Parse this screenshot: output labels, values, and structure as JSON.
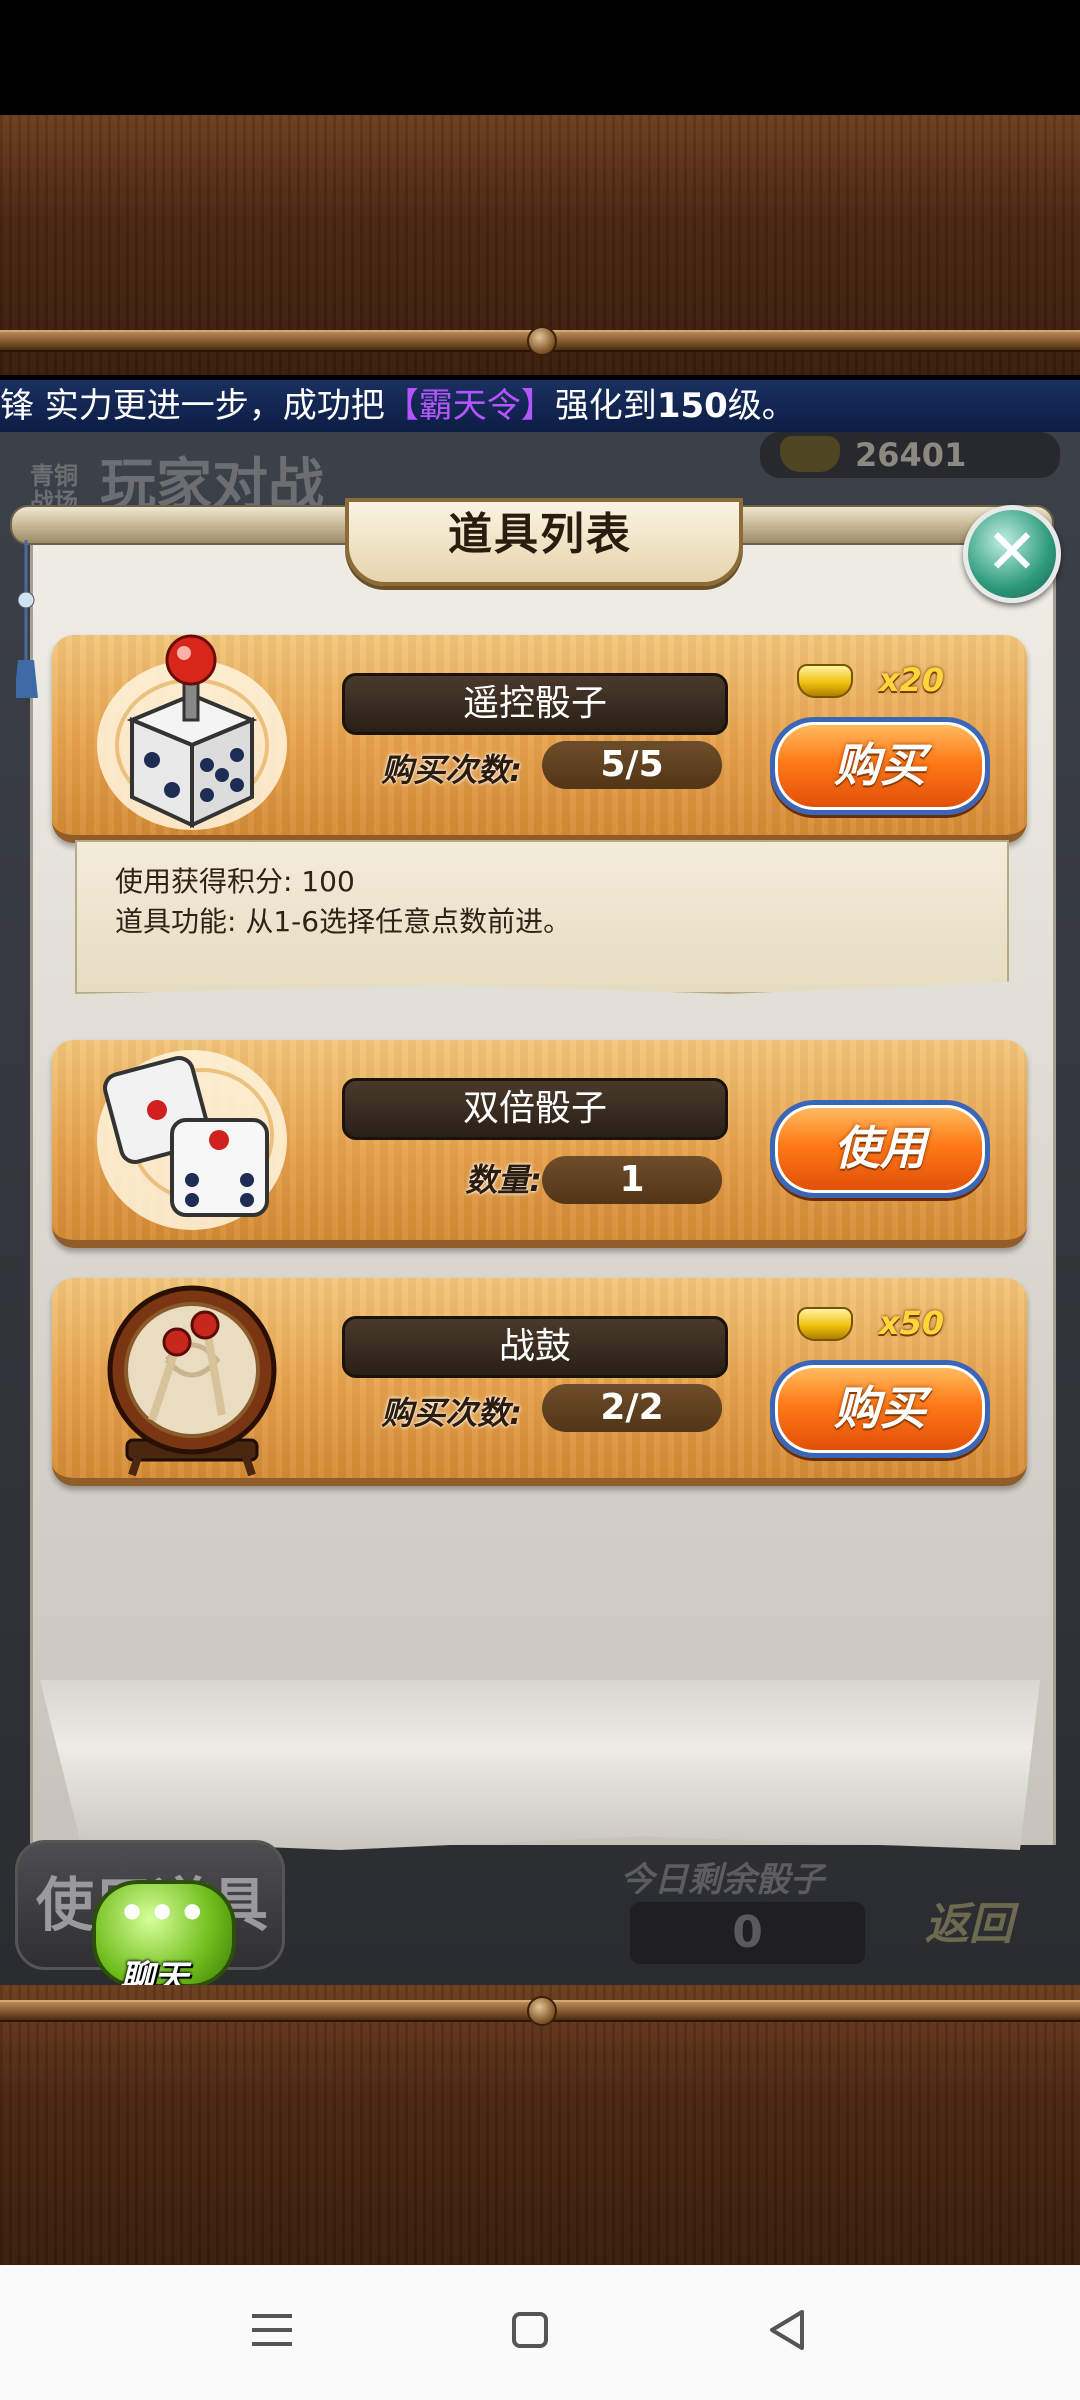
{
  "ticker": {
    "part1": "锋 实力更进一步，成功把",
    "item": "【霸天令】",
    "part2": "强化到",
    "level": "150",
    "part3": "级。"
  },
  "background": {
    "mode_tag": "青铜战场",
    "mode_title": "玩家对战",
    "gold_amount": "26401",
    "use_item_button": "使用道具",
    "chat_label": "聊天",
    "dice_left_label": "今日剩余骰子",
    "dice_left_value": "0",
    "back_button": "返回"
  },
  "panel": {
    "title": "道具列表",
    "close_icon": "close-x-icon"
  },
  "items": [
    {
      "name": "遥控骰子",
      "stat_label": "购买次数:",
      "stat_value": "5/5",
      "cost": "x20",
      "button": "购买",
      "icon": "remote-dice-icon",
      "description": [
        "使用获得积分: 100",
        "道具功能: 从1-6选择任意点数前进。"
      ]
    },
    {
      "name": "双倍骰子",
      "stat_label": "数量:",
      "stat_value": "1",
      "button": "使用",
      "icon": "double-dice-icon"
    },
    {
      "name": "战鼓",
      "stat_label": "购买次数:",
      "stat_value": "2/2",
      "cost": "x50",
      "button": "购买",
      "icon": "war-drum-icon"
    }
  ],
  "colors": {
    "button_orange": "#ff7a18",
    "button_border": "#3a66b8",
    "card_gold": "#e7a24c",
    "ticker_bg": "#0c1d45",
    "ticker_highlight": "#b455ff"
  },
  "navbar": {
    "menu_icon": "menu-icon",
    "home_icon": "home-square-icon",
    "back_icon": "back-triangle-icon"
  }
}
